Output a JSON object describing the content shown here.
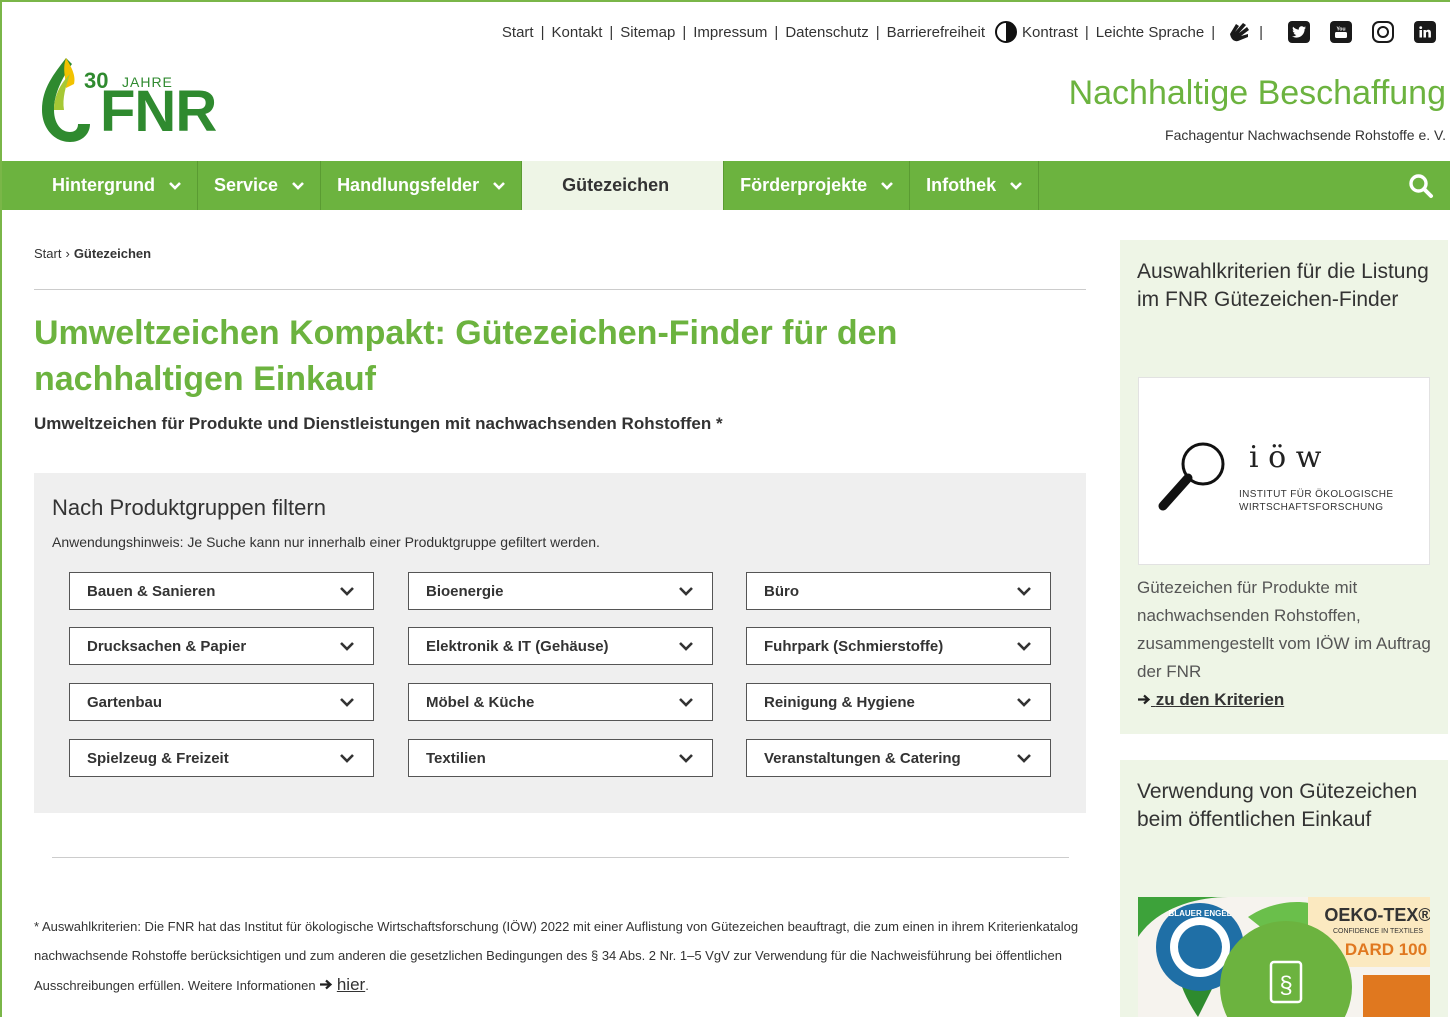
{
  "meta_links": [
    "Start",
    "Kontakt",
    "Sitemap",
    "Impressum",
    "Datenschutz",
    "Barrierefreiheit"
  ],
  "contrast_label": "Kontrast",
  "easy_language": "Leichte Sprache",
  "logo": {
    "years": "30",
    "jahre": "JAHRE",
    "name": "FNR"
  },
  "site": {
    "title": "Nachhaltige Beschaffung",
    "subtitle": "Fachagentur Nachwachsende Rohstoffe e. V."
  },
  "nav": {
    "items": [
      {
        "label": "Hintergrund"
      },
      {
        "label": "Service"
      },
      {
        "label": "Handlungsfelder"
      },
      {
        "label": "Gütezeichen"
      },
      {
        "label": "Förderprojekte"
      },
      {
        "label": "Infothek"
      }
    ]
  },
  "breadcrumb": {
    "home": "Start",
    "current": "Gütezeichen"
  },
  "page": {
    "title": "Umweltzeichen Kompakt: Gütezeichen-Finder für den nachhaltigen Einkauf",
    "lead": "Umweltzeichen für Produkte und Dienstleistungen mit nachwachsenden Rohstoffen *"
  },
  "filter": {
    "heading": "Nach Produktgruppen filtern",
    "hint": "Anwendungshinweis: Je Suche kann nur innerhalb einer Produktgruppe gefiltert werden.",
    "selects": [
      "Bauen & Sanieren",
      "Bioenergie",
      "Büro",
      "Drucksachen & Papier",
      "Elektronik & IT (Gehäuse)",
      "Fuhrpark (Schmierstoffe)",
      "Gartenbau",
      "Möbel & Küche",
      "Reinigung & Hygiene",
      "Spielzeug & Freizeit",
      "Textilien",
      "Veranstaltungen & Catering"
    ]
  },
  "footnote": {
    "text": "* Auswahlkriterien: Die FNR hat das Institut für ökologische Wirtschaftsforschung (IÖW) 2022 mit einer Auflistung von Gütezeichen beauftragt, die zum einen in ihrem Kriterienkatalog nachwachsende Rohstoffe berücksichtigen und zum anderen die gesetzlichen Bedingungen des § 34 Abs. 2 Nr. 1–5 VgV zur Verwendung für die Nachweisführung bei öffentlichen Ausschreibungen erfüllen. Weitere Informationen",
    "link": "hier"
  },
  "sidebar": {
    "box1": {
      "title": "Auswahlkriterien für die Listung im FNR Gütezeichen-Finder",
      "logo_text": "i ö w",
      "logo_sub": "INSTITUT FÜR ÖKOLOGISCHE WIRTSCHAFTSFORSCHUNG",
      "desc": "Gütezeichen für Produkte mit nachwachsenden Rohstoffen, zusammengestellt vom IÖW im Auftrag der FNR",
      "link": "zu den Kriterien"
    },
    "box2": {
      "title": "Verwendung von Gütezeichen beim öffentlichen Einkauf",
      "badge": "§",
      "oeko_tex": "OEKO-TEX®",
      "oeko_tex_sub": "CONFIDENCE IN TEXTILES",
      "oeko_tex_std": "DARD 100",
      "blauer_engel": "BLAUER ENGEL"
    }
  },
  "colors": {
    "brand_green": "#6cb33f",
    "dark_green": "#2f8a2f",
    "nav_active_bg": "#eef5e6"
  },
  "icons": [
    "contrast-icon",
    "sign-language-icon",
    "twitter-icon",
    "youtube-icon",
    "instagram-icon",
    "linkedin-icon",
    "search-icon",
    "chevron-down-icon",
    "magnifier-icon",
    "arrow-right-icon"
  ]
}
